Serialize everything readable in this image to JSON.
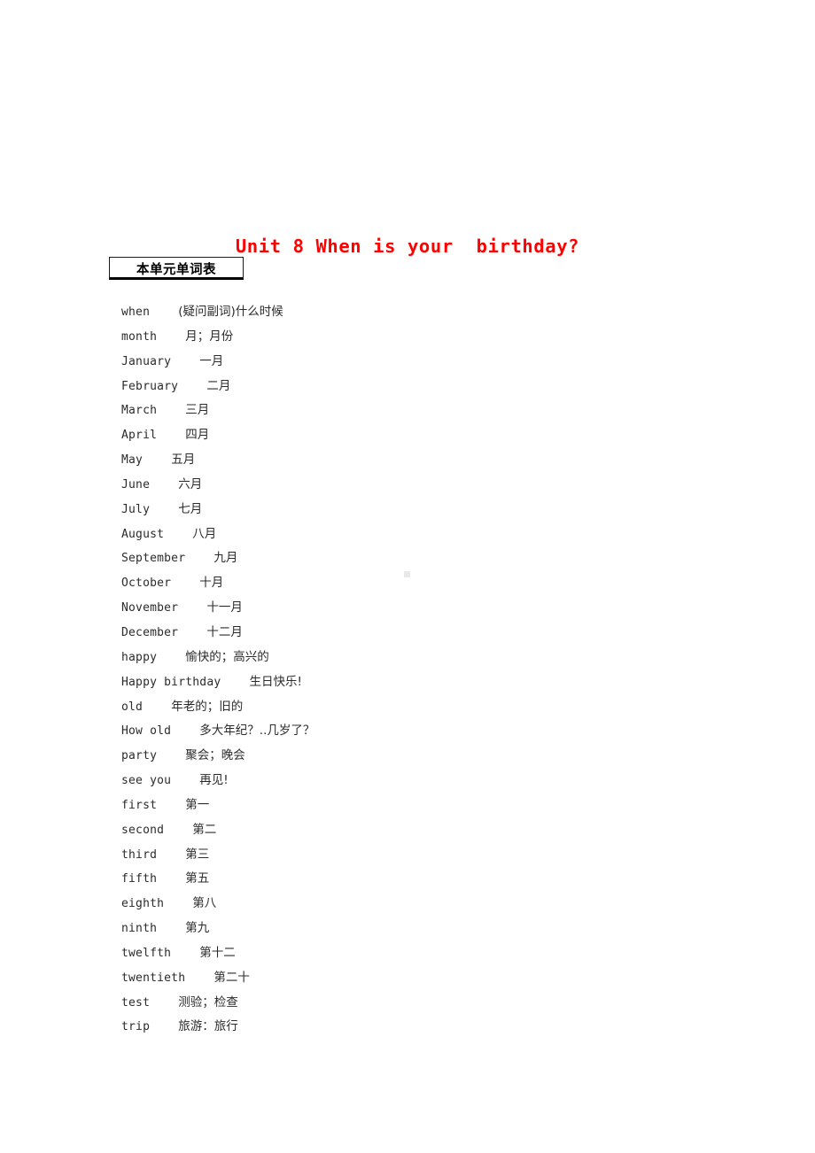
{
  "document": {
    "title": "Unit 8 When is your  birthday?",
    "title_color": "#ff0000",
    "section_box_label": "本单元单词表"
  },
  "wordlist": [
    {
      "en": "when",
      "gap": "    ",
      "zh": "(疑问副词)什么时候"
    },
    {
      "en": "month",
      "gap": "    ",
      "zh": "月；月份"
    },
    {
      "en": "January",
      "gap": "    ",
      "zh": "一月"
    },
    {
      "en": "February",
      "gap": "    ",
      "zh": "二月"
    },
    {
      "en": "March",
      "gap": "    ",
      "zh": "三月"
    },
    {
      "en": "April",
      "gap": "    ",
      "zh": "四月"
    },
    {
      "en": "May",
      "gap": "    ",
      "zh": "五月"
    },
    {
      "en": "June",
      "gap": "    ",
      "zh": "六月"
    },
    {
      "en": "July",
      "gap": "    ",
      "zh": "七月"
    },
    {
      "en": "August",
      "gap": "    ",
      "zh": "八月"
    },
    {
      "en": "September",
      "gap": "    ",
      "zh": "九月"
    },
    {
      "en": "October",
      "gap": "    ",
      "zh": "十月"
    },
    {
      "en": "November",
      "gap": "    ",
      "zh": "十一月"
    },
    {
      "en": "December",
      "gap": "    ",
      "zh": "十二月"
    },
    {
      "en": "happy",
      "gap": "    ",
      "zh": "愉快的；高兴的"
    },
    {
      "en": "Happy birthday",
      "gap": "    ",
      "zh": "生日快乐!"
    },
    {
      "en": "old",
      "gap": "    ",
      "zh": "年老的；旧的"
    },
    {
      "en": "How old",
      "gap": "    ",
      "zh": "多大年纪？..几岁了？"
    },
    {
      "en": "party",
      "gap": "    ",
      "zh": "聚会；晚会"
    },
    {
      "en": "see you",
      "gap": "    ",
      "zh": "再见!"
    },
    {
      "en": "first",
      "gap": "    ",
      "zh": "第一"
    },
    {
      "en": "second",
      "gap": "    ",
      "zh": "第二"
    },
    {
      "en": "third",
      "gap": "    ",
      "zh": "第三"
    },
    {
      "en": "fifth",
      "gap": "    ",
      "zh": "第五"
    },
    {
      "en": "eighth",
      "gap": "    ",
      "zh": "第八"
    },
    {
      "en": "ninth",
      "gap": "    ",
      "zh": "第九"
    },
    {
      "en": "twelfth",
      "gap": "    ",
      "zh": "第十二"
    },
    {
      "en": "twentieth",
      "gap": "    ",
      "zh": "第二十"
    },
    {
      "en": "test",
      "gap": "    ",
      "zh": "测验；检查"
    },
    {
      "en": "trip",
      "gap": "    ",
      "zh": "旅游：旅行"
    }
  ]
}
